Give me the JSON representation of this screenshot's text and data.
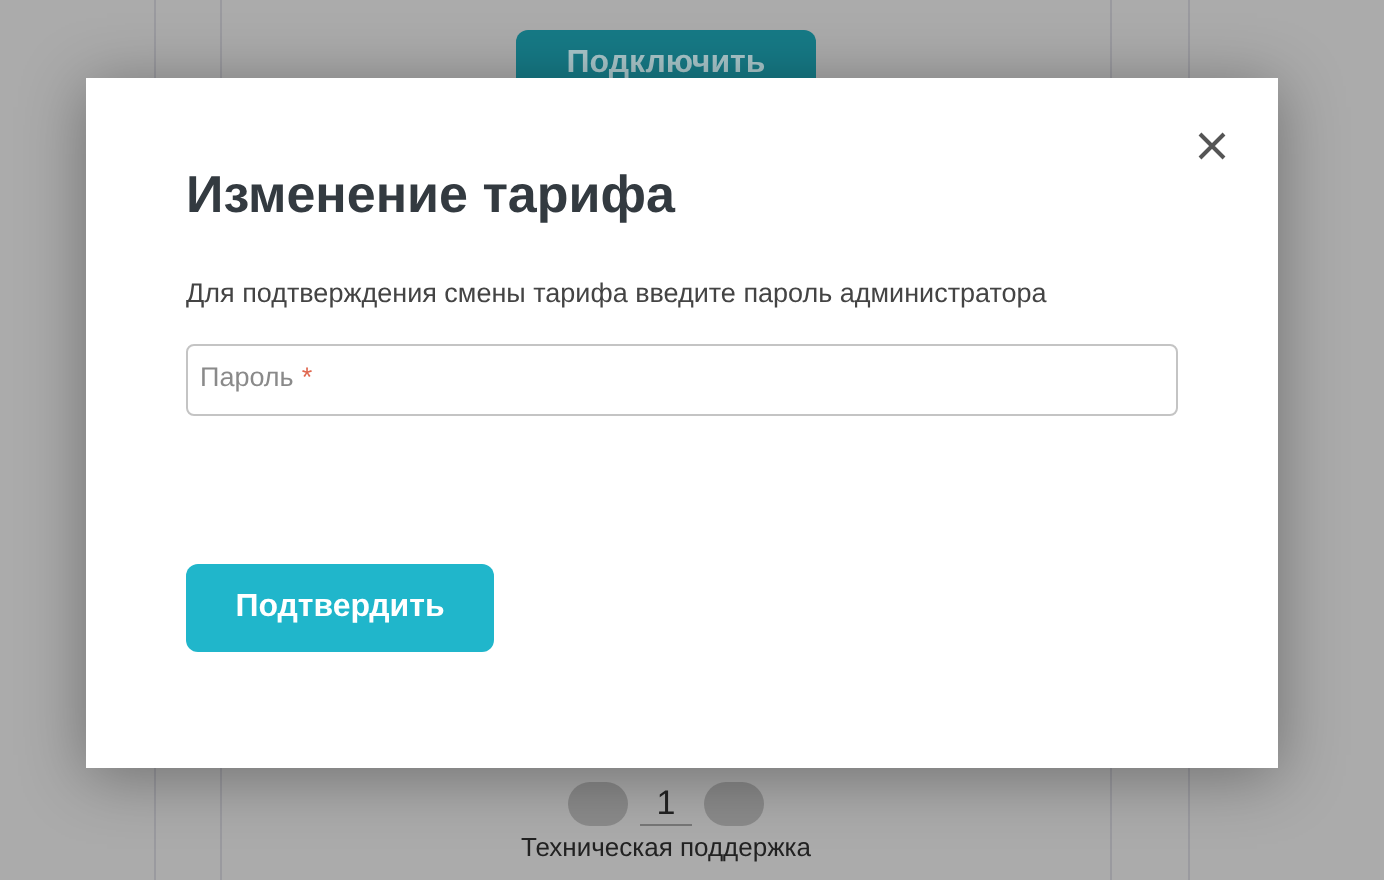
{
  "background": {
    "connect_button": "Подключить",
    "quantity": "1",
    "support_link": "Техническая поддержка"
  },
  "dialog": {
    "title": "Изменение тарифа",
    "message": "Для подтверждения смены тарифа введите пароль администратора",
    "password_field": {
      "label": "Пароль",
      "required_mark": "*"
    },
    "confirm_button": "Подтвердить"
  }
}
